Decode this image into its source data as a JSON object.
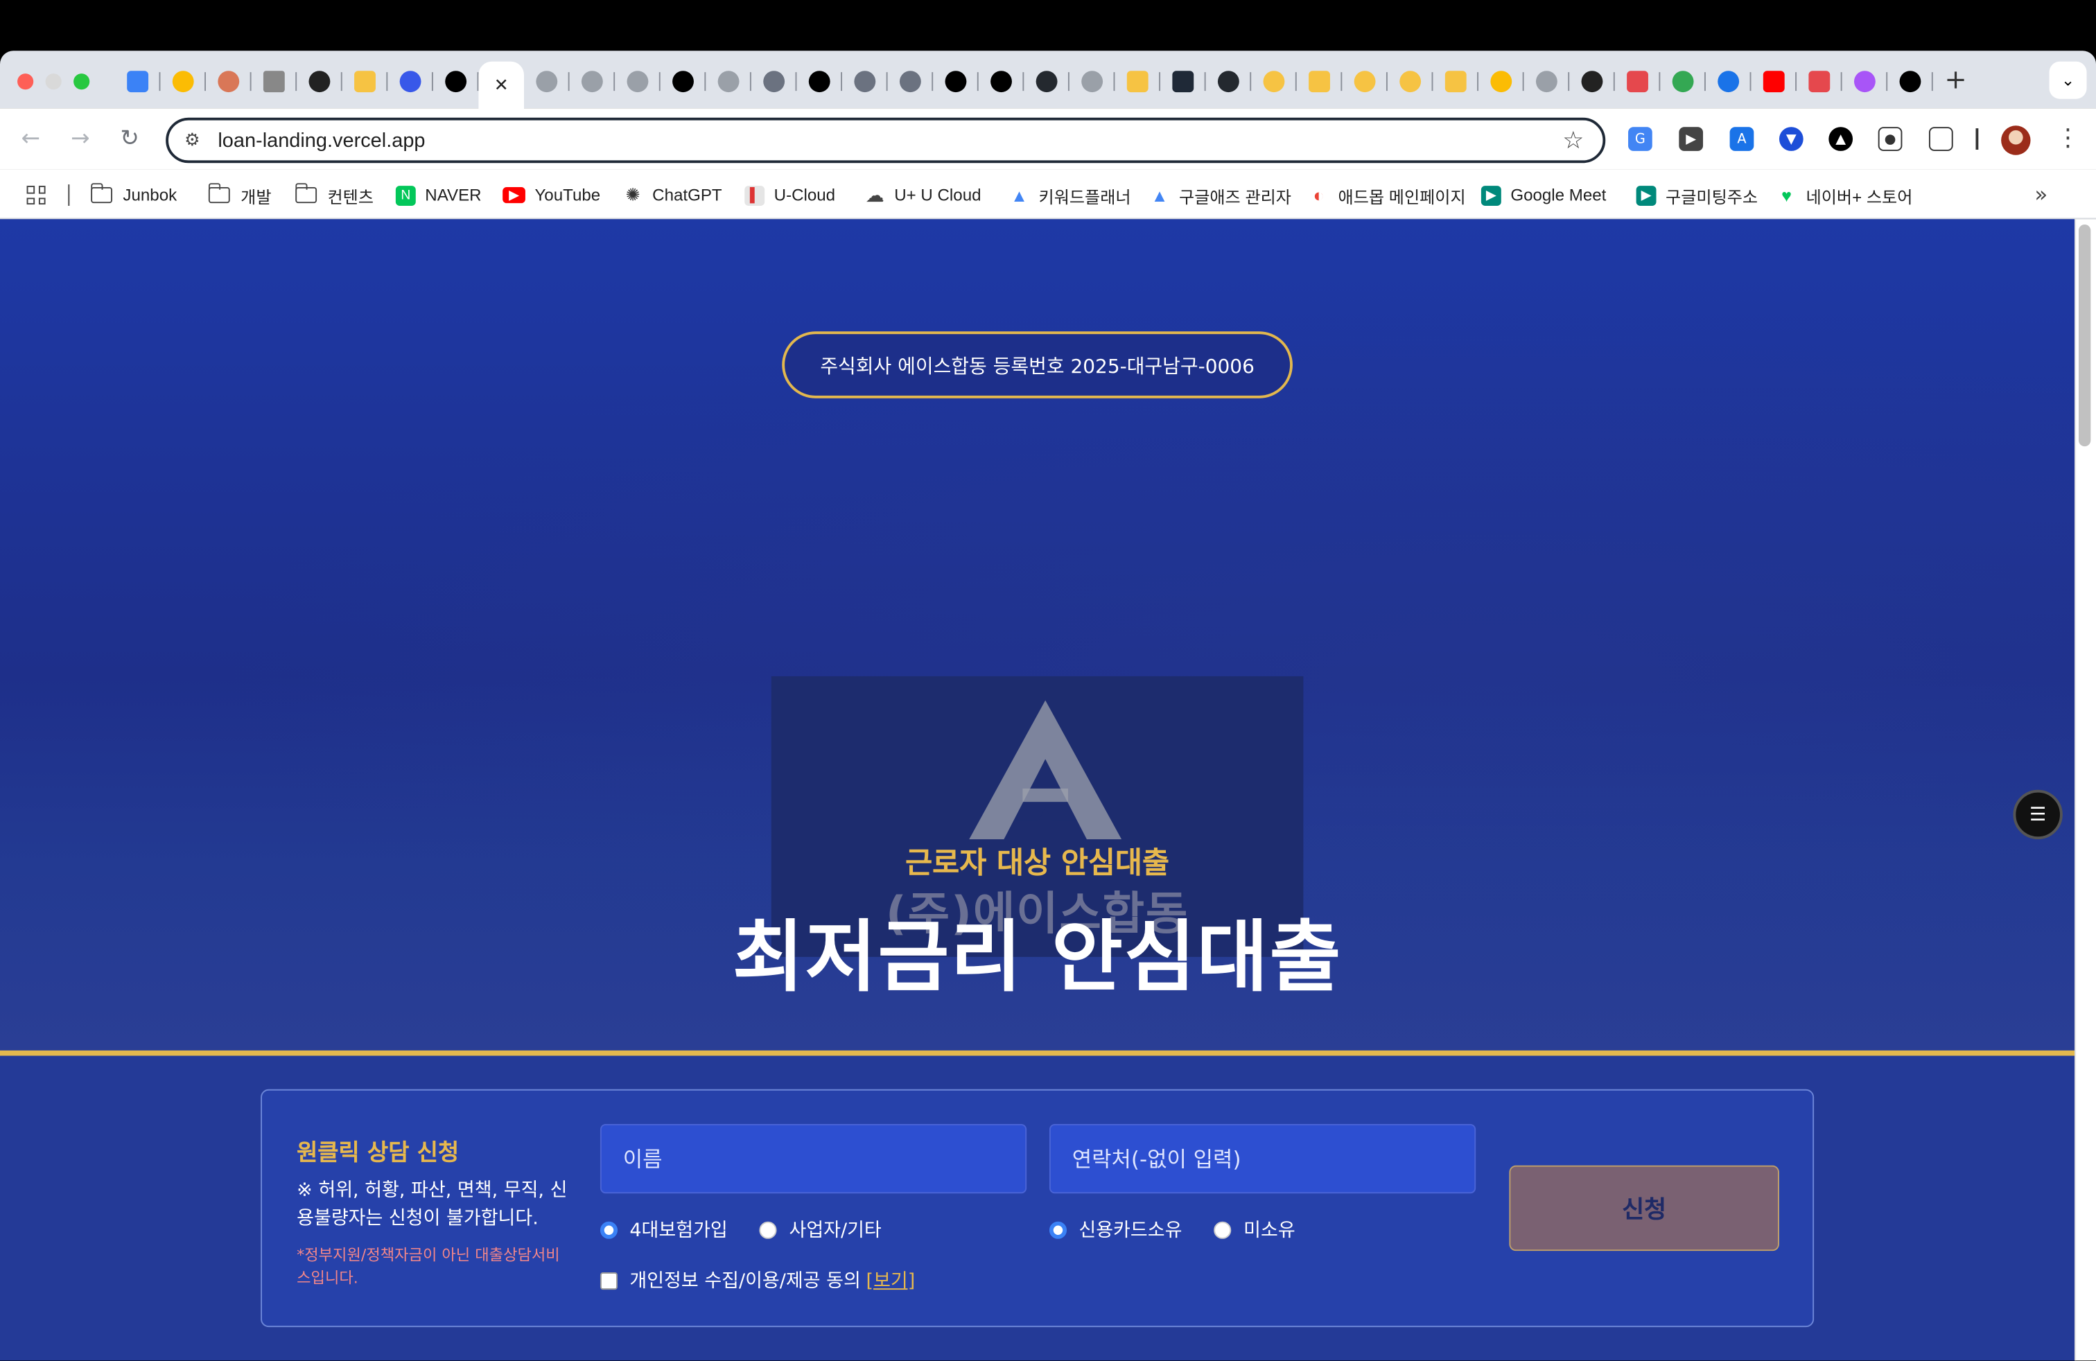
{
  "browser": {
    "address_url": "loan-landing.vercel.app",
    "new_tab_symbol": "+",
    "active_tab_close": "✕",
    "tab_menu_symbol": "⌄",
    "bookmarks": [
      {
        "label": "Junbok",
        "icon": "folder-icon"
      },
      {
        "label": "개발",
        "icon": "folder-icon"
      },
      {
        "label": "컨텐츠",
        "icon": "folder-icon"
      },
      {
        "label": "NAVER",
        "icon": "naver-icon"
      },
      {
        "label": "YouTube",
        "icon": "youtube-icon"
      },
      {
        "label": "ChatGPT",
        "icon": "chatgpt-icon"
      },
      {
        "label": "U-Cloud",
        "icon": "ucloud-icon"
      },
      {
        "label": "U+ U Cloud",
        "icon": "cloud-icon"
      },
      {
        "label": "키워드플래너",
        "icon": "google-ads-icon"
      },
      {
        "label": "구글애즈 관리자",
        "icon": "google-ads-icon"
      },
      {
        "label": "애드몹 메인페이지",
        "icon": "admob-icon"
      },
      {
        "label": "Google Meet",
        "icon": "meet-icon"
      },
      {
        "label": "구글미팅주소",
        "icon": "meet-icon"
      },
      {
        "label": "네이버+ 스토어",
        "icon": "naver-store-icon"
      }
    ]
  },
  "page": {
    "registration": "주식회사 에이스합동 등록번호 2025-대구남구-0006",
    "logo_text": "(주)에이스합동",
    "hero_subtitle": "근로자 대상 안심대출",
    "hero_title": "최저금리 안심대출",
    "form": {
      "title": "원클릭 상담 신청",
      "notice": "※ 허위, 허황, 파산, 면책, 무직, 신용불량자는 신청이 불가합니다.",
      "sub_notice": "*정부지원/정책자금이 아닌 대출상담서비스입니다.",
      "name_placeholder": "이름",
      "phone_placeholder": "연락처(-없이 입력)",
      "employment_options": [
        "4대보험가입",
        "사업자/기타"
      ],
      "employment_selected": "4대보험가입",
      "card_options": [
        "신용카드소유",
        "미소유"
      ],
      "card_selected": "신용카드소유",
      "agree_label": "개인정보 수집/이용/제공 동의",
      "view_link": "[보기]",
      "submit_label": "신청"
    }
  }
}
